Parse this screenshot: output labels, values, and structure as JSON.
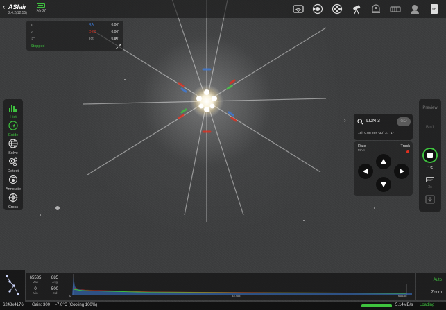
{
  "app": {
    "brand": "ASIair",
    "version": "2.4.2(12.55)",
    "time": "20:20",
    "accent": "#3ec23e"
  },
  "top_icons": [
    "wifi-icon",
    "camera-icon",
    "filter-wheel-icon",
    "telescope-icon",
    "focuser-icon",
    "guider-icon",
    "rotator-icon",
    "storage-icon"
  ],
  "storage_badge": "SD",
  "guide_graph": {
    "rows": [
      {
        "label": "3\"",
        "metric": "RA",
        "value": "0.00\"",
        "color": "#3d7bd9"
      },
      {
        "label": "0\"",
        "metric": "DEC",
        "value": "0.00\"",
        "color": "#e0301f"
      },
      {
        "label": "-3\"",
        "metric": "Tot",
        "value": "0.00\"",
        "color": "#aaaaaa"
      }
    ],
    "status": "Stopped"
  },
  "sidebar": {
    "items": [
      {
        "name": "hist",
        "label": "Hist",
        "icon": "histogram-icon",
        "active": true
      },
      {
        "name": "guide",
        "label": "Guide",
        "icon": "guide-icon",
        "active": true
      },
      {
        "name": "solve",
        "label": "Solve",
        "icon": "globe-icon",
        "active": false
      },
      {
        "name": "detect",
        "label": "Detect",
        "icon": "detect-icon",
        "active": false
      },
      {
        "name": "annotate",
        "label": "Annotate",
        "icon": "annotate-icon",
        "active": false
      },
      {
        "name": "cross",
        "label": "Cross",
        "icon": "crosshair-icon",
        "active": false
      }
    ]
  },
  "target": {
    "name": "LDN 3",
    "go_label": "GO",
    "coords": "18h 07m 26s -30° 27' 17\""
  },
  "mount": {
    "rate_label": "Rate",
    "rate_value": "MAX",
    "track_label": "Track"
  },
  "capture": {
    "preview_label": "Preview",
    "bin_label": "Bin1",
    "exposure": "1s",
    "exp_tag": "EXP",
    "exp_sub": "3s"
  },
  "histogram": {
    "max": "65535",
    "max_label": "Max",
    "avg": "885",
    "avg_label": "Avg",
    "min": "0",
    "min_label": "Min",
    "std": "500",
    "std_label": "Std",
    "axis": [
      "0",
      "32768",
      "65535"
    ],
    "auto_label": "Auto",
    "zoom_label": "Zoom"
  },
  "status": {
    "resolution": "6248x4176",
    "gain": "Gain: 300",
    "temp": "-7.0°C (Cooling 100%)",
    "speed": "5.14MB/s",
    "state": "Loading",
    "progress": 1.0
  }
}
